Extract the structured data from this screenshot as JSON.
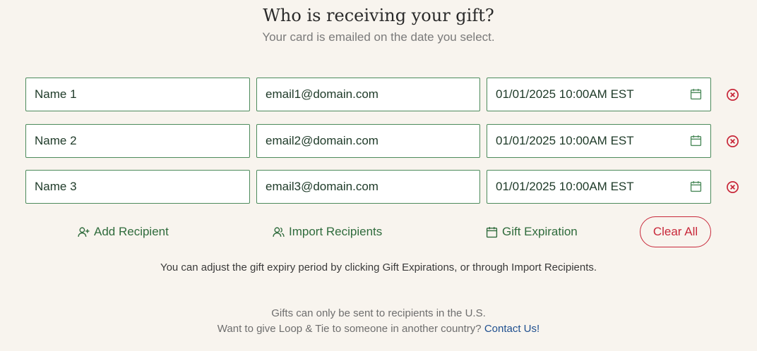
{
  "header": {
    "title": "Who is receiving your gift?",
    "subtitle": "Your card is emailed on the date you select."
  },
  "recipients": [
    {
      "name": "Name 1",
      "email": "email1@domain.com",
      "date": "01/01/2025 10:00AM EST"
    },
    {
      "name": "Name 2",
      "email": "email2@domain.com",
      "date": "01/01/2025 10:00AM EST"
    },
    {
      "name": "Name 3",
      "email": "email3@domain.com",
      "date": "01/01/2025 10:00AM EST"
    }
  ],
  "icons": {
    "date_field": "calendar-icon",
    "remove": "remove-circle-x-icon",
    "add_recipient": "user-plus-icon",
    "import_recipients": "users-icon",
    "gift_expiration": "calendar-icon"
  },
  "actions": {
    "add_recipient": "Add Recipient",
    "import_recipients": "Import Recipients",
    "gift_expiration": "Gift Expiration",
    "clear_all": "Clear All"
  },
  "note": "You can adjust the gift expiry period by clicking Gift Expirations, or through Import Recipients.",
  "footer": {
    "line1": "Gifts can only be sent to recipients in the U.S.",
    "line2": "Want to give Loop & Tie to someone in another country?",
    "contact_link": "Contact Us!"
  },
  "colors": {
    "background": "#f8f4ee",
    "field_border": "#4c8a5b",
    "action_green": "#2f6b3c",
    "danger_red": "#c8283a",
    "link_blue": "#1f4f8f"
  }
}
